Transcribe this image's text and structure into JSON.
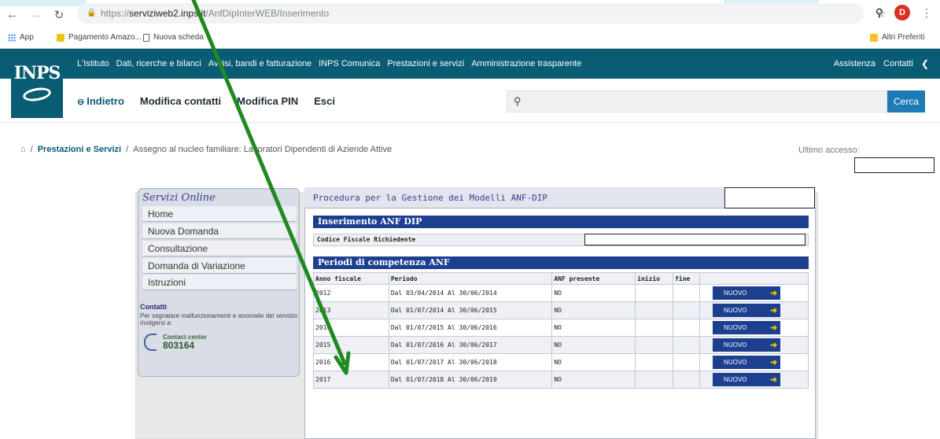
{
  "browser": {
    "url_host": "serviziweb2.inps.it",
    "url_path": "/AnfDipInterWEB/Inserimento",
    "url_prefix": "https://",
    "profile_initial": "D",
    "bookmarks": [
      "App",
      "Pagamento Amazo...",
      "Nuova scheda"
    ],
    "other_bookmarks": "Altri Preferiti"
  },
  "header": {
    "logo_text": "INPS",
    "top_nav": [
      "L'Istituto",
      "Dati, ricerche e bilanci",
      "Avvisi, bandi e fatturazione",
      "INPS Comunica",
      "Prestazioni e servizi",
      "Amministrazione trasparente"
    ],
    "right_nav": [
      "Assistenza",
      "Contatti"
    ],
    "back_label": "Indietro",
    "sub_nav": [
      "Modifica contatti",
      "Modifica PIN",
      "Esci"
    ],
    "search_button": "Cerca"
  },
  "breadcrumb": {
    "section": "Prestazioni e Servizi",
    "page": "Assegno al nucleo familiare: Lavoratori Dipendenti di Aziende Attive",
    "last_access_label": "Ultimo accesso:"
  },
  "sidebar": {
    "title": "Servizi Online",
    "items": [
      "Home",
      "Nuova Domanda",
      "Consultazione",
      "Domanda di Variazione",
      "Istruzioni"
    ],
    "contacts_title": "Contatti",
    "contacts_text": "Per segnalare malfunzionamenti e anomalie del servizio rivolgersi a:",
    "contact_center_label": "Contact center",
    "contact_center_number": "803164"
  },
  "main": {
    "title": "Procedura per la Gestione dei Modelli ANF-DIP",
    "section1_title": "Inserimento ANF DIP",
    "cf_label": "Codice Fiscale Richiedente",
    "section2_title": "Periodi di competenza ANF",
    "columns": [
      "Anno fiscale",
      "Periodo",
      "ANF presente",
      "inizio",
      "fine",
      ""
    ],
    "rows": [
      {
        "anno": "2012",
        "periodo": "Dal 03/04/2014 Al 30/06/2014",
        "presente": "NO"
      },
      {
        "anno": "2013",
        "periodo": "Dal 01/07/2014 Al 30/06/2015",
        "presente": "NO"
      },
      {
        "anno": "2014",
        "periodo": "Dal 01/07/2015 Al 30/06/2016",
        "presente": "NO"
      },
      {
        "anno": "2015",
        "periodo": "Dal 01/07/2016 Al 30/06/2017",
        "presente": "NO"
      },
      {
        "anno": "2016",
        "periodo": "Dal 01/07/2017 Al 30/06/2018",
        "presente": "NO"
      },
      {
        "anno": "2017",
        "periodo": "Dal 01/07/2018 Al 30/06/2019",
        "presente": "NO"
      }
    ],
    "button_label": "NUOVO"
  },
  "colors": {
    "inps_blue": "#0a5b74",
    "panel_blue": "#1d3f8f",
    "arrow_green": "#1f8a1f"
  }
}
